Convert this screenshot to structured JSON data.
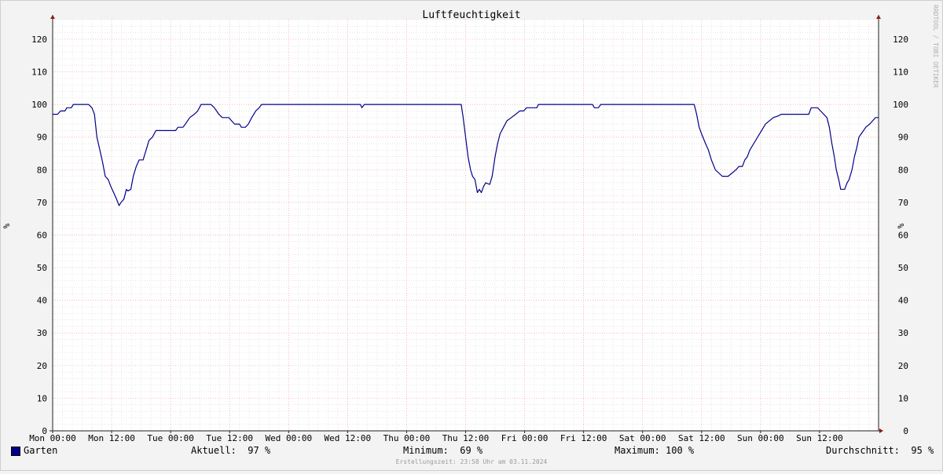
{
  "chart_data": {
    "type": "line",
    "title": "Luftfeuchtigkeit",
    "ylabel": "%",
    "ylabel_right": "%",
    "watermark": "RRDTOOL / TOBI OETIKER",
    "ylim": [
      0,
      126
    ],
    "yticks": [
      0,
      10,
      20,
      30,
      40,
      50,
      60,
      70,
      80,
      90,
      100,
      110,
      120
    ],
    "xlim": [
      0,
      168
    ],
    "xticks": [
      {
        "x": 0,
        "label": "Mon 00:00"
      },
      {
        "x": 12,
        "label": "Mon 12:00"
      },
      {
        "x": 24,
        "label": "Tue 00:00"
      },
      {
        "x": 36,
        "label": "Tue 12:00"
      },
      {
        "x": 48,
        "label": "Wed 00:00"
      },
      {
        "x": 60,
        "label": "Wed 12:00"
      },
      {
        "x": 72,
        "label": "Thu 00:00"
      },
      {
        "x": 84,
        "label": "Thu 12:00"
      },
      {
        "x": 96,
        "label": "Fri 00:00"
      },
      {
        "x": 108,
        "label": "Fri 12:00"
      },
      {
        "x": 120,
        "label": "Sat 00:00"
      },
      {
        "x": 132,
        "label": "Sat 12:00"
      },
      {
        "x": 144,
        "label": "Sun 00:00"
      },
      {
        "x": 156,
        "label": "Sun 12:00"
      }
    ],
    "grid": true,
    "legend_position": "bottom-left",
    "series": [
      {
        "name": "Garten",
        "color": "#00008b",
        "points": [
          [
            0,
            97
          ],
          [
            1,
            97
          ],
          [
            1.6,
            98
          ],
          [
            2.5,
            98
          ],
          [
            2.9,
            99
          ],
          [
            3.8,
            99
          ],
          [
            4.2,
            100
          ],
          [
            7.3,
            100
          ],
          [
            8,
            99
          ],
          [
            8.5,
            97
          ],
          [
            9,
            90
          ],
          [
            9.6,
            86
          ],
          [
            10.2,
            82
          ],
          [
            10.7,
            78
          ],
          [
            11.3,
            77
          ],
          [
            11.8,
            75
          ],
          [
            12.4,
            73
          ],
          [
            13,
            71
          ],
          [
            13.5,
            69
          ],
          [
            13.9,
            70
          ],
          [
            14.5,
            71
          ],
          [
            15,
            74
          ],
          [
            15.3,
            73.5
          ],
          [
            15.9,
            74
          ],
          [
            16.4,
            78
          ],
          [
            17,
            81
          ],
          [
            17.6,
            83
          ],
          [
            18.4,
            83
          ],
          [
            19,
            86
          ],
          [
            19.6,
            89
          ],
          [
            20.3,
            90
          ],
          [
            21,
            92
          ],
          [
            25,
            92
          ],
          [
            25.5,
            93
          ],
          [
            26.5,
            93
          ],
          [
            27,
            94
          ],
          [
            27.9,
            96
          ],
          [
            28.8,
            97
          ],
          [
            29.5,
            98
          ],
          [
            30.2,
            100
          ],
          [
            32.2,
            100
          ],
          [
            32.9,
            99
          ],
          [
            33.8,
            97
          ],
          [
            34.5,
            96
          ],
          [
            35.8,
            96
          ],
          [
            36.4,
            95
          ],
          [
            37,
            94
          ],
          [
            38,
            94
          ],
          [
            38.4,
            93
          ],
          [
            39.2,
            93
          ],
          [
            39.8,
            94
          ],
          [
            40.5,
            96
          ],
          [
            41.3,
            98
          ],
          [
            42,
            99
          ],
          [
            42.5,
            100
          ],
          [
            62.6,
            100
          ],
          [
            62.9,
            99
          ],
          [
            63.4,
            100
          ],
          [
            83.1,
            100
          ],
          [
            83.5,
            96
          ],
          [
            84,
            90
          ],
          [
            84.5,
            84
          ],
          [
            85,
            80
          ],
          [
            85.4,
            78
          ],
          [
            85.9,
            77
          ],
          [
            86.4,
            73
          ],
          [
            86.8,
            74
          ],
          [
            87.2,
            73
          ],
          [
            87.7,
            75
          ],
          [
            88.1,
            76
          ],
          [
            88.9,
            75.5
          ],
          [
            89.4,
            78
          ],
          [
            90,
            84
          ],
          [
            90.5,
            88
          ],
          [
            91,
            91
          ],
          [
            91.7,
            93
          ],
          [
            92.4,
            95
          ],
          [
            93.3,
            96
          ],
          [
            94.2,
            97
          ],
          [
            95,
            98
          ],
          [
            95.8,
            98
          ],
          [
            96.4,
            99
          ],
          [
            98.5,
            99
          ],
          [
            98.8,
            100
          ],
          [
            109.8,
            100
          ],
          [
            110.2,
            99
          ],
          [
            111,
            99
          ],
          [
            111.5,
            100
          ],
          [
            130.5,
            100
          ],
          [
            131,
            97
          ],
          [
            131.5,
            93
          ],
          [
            132,
            91
          ],
          [
            132.8,
            88
          ],
          [
            133.4,
            86
          ],
          [
            134,
            83
          ],
          [
            134.8,
            80
          ],
          [
            135.5,
            79
          ],
          [
            136.2,
            78
          ],
          [
            137.4,
            78
          ],
          [
            138.2,
            79
          ],
          [
            139,
            80
          ],
          [
            139.6,
            81
          ],
          [
            140.3,
            81
          ],
          [
            140.8,
            83
          ],
          [
            141.3,
            84
          ],
          [
            141.8,
            86
          ],
          [
            142.6,
            88
          ],
          [
            143.4,
            90
          ],
          [
            144.2,
            92
          ],
          [
            145,
            94
          ],
          [
            145.8,
            95
          ],
          [
            146.6,
            96
          ],
          [
            147.6,
            96.5
          ],
          [
            148.2,
            97
          ],
          [
            153.8,
            97
          ],
          [
            154.3,
            99
          ],
          [
            155.6,
            99
          ],
          [
            156.2,
            98
          ],
          [
            157.5,
            96
          ],
          [
            158,
            93
          ],
          [
            158.5,
            88
          ],
          [
            159,
            84
          ],
          [
            159.4,
            80
          ],
          [
            159.9,
            77
          ],
          [
            160.3,
            74
          ],
          [
            161.1,
            74
          ],
          [
            161.6,
            76
          ],
          [
            162,
            77
          ],
          [
            162.6,
            80
          ],
          [
            163.1,
            84
          ],
          [
            163.6,
            87
          ],
          [
            164,
            90
          ],
          [
            164.7,
            91.5
          ],
          [
            165.4,
            93
          ],
          [
            166.2,
            94
          ],
          [
            166.8,
            95
          ],
          [
            167.4,
            96
          ],
          [
            168,
            96
          ]
        ]
      }
    ]
  },
  "legend": {
    "series_name": "Garten",
    "series_color": "#00008b",
    "aktuell": "Aktuell:  97 %",
    "minimum": "Minimum:  69 %",
    "maximum": "Maximum: 100 %",
    "durchschnitt": "Durchschnitt:  95 %"
  },
  "footer": "Erstellungszeit: 23:58 Uhr am 03.11.2024"
}
